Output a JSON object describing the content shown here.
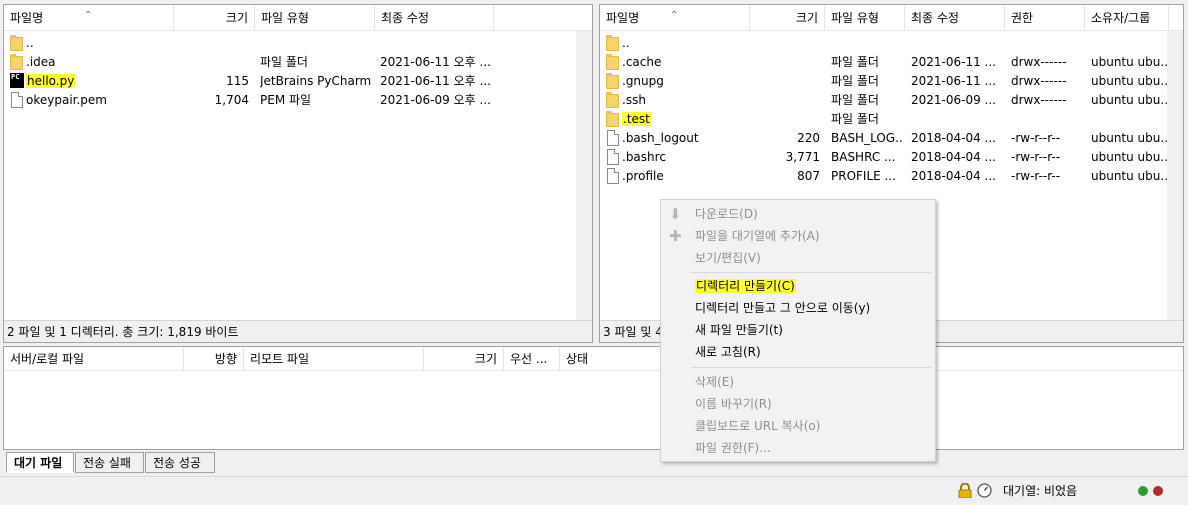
{
  "local": {
    "columns": {
      "name": "파일명",
      "size": "크기",
      "type": "파일 유형",
      "modified": "최종 수정"
    },
    "rows": [
      {
        "icon": "folder-icon",
        "name": "..",
        "size": "",
        "type": "",
        "modified": ""
      },
      {
        "icon": "folder-icon",
        "name": ".idea",
        "size": "",
        "type": "파일 폴더",
        "modified": "2021-06-11 오후 ..."
      },
      {
        "icon": "pycharm-file-icon",
        "name": "hello.py",
        "size": "115",
        "type": "JetBrains PyCharm...",
        "modified": "2021-06-11 오후 ..."
      },
      {
        "icon": "file-icon",
        "name": "okeypair.pem",
        "size": "1,704",
        "type": "PEM 파일",
        "modified": "2021-06-09 오후 ..."
      }
    ],
    "status": "2 파일 및 1 디렉터리. 총 크기: 1,819 바이트"
  },
  "remote": {
    "columns": {
      "name": "파일명",
      "size": "크기",
      "type": "파일 유형",
      "modified": "최종 수정",
      "perms": "권한",
      "owner": "소유자/그룹"
    },
    "rows": [
      {
        "icon": "folder-icon",
        "name": "..",
        "size": "",
        "type": "",
        "modified": "",
        "perms": "",
        "owner": ""
      },
      {
        "icon": "folder-icon",
        "name": ".cache",
        "size": "",
        "type": "파일 폴더",
        "modified": "2021-06-11 ...",
        "perms": "drwx------",
        "owner": "ubuntu ubu..."
      },
      {
        "icon": "folder-icon",
        "name": ".gnupg",
        "size": "",
        "type": "파일 폴더",
        "modified": "2021-06-11 ...",
        "perms": "drwx------",
        "owner": "ubuntu ubu..."
      },
      {
        "icon": "folder-icon",
        "name": ".ssh",
        "size": "",
        "type": "파일 폴더",
        "modified": "2021-06-09 ...",
        "perms": "drwx------",
        "owner": "ubuntu ubu..."
      },
      {
        "icon": "folder-icon",
        "name": ".test",
        "size": "",
        "type": "파일 폴더",
        "modified": "",
        "perms": "",
        "owner": ""
      },
      {
        "icon": "file-icon",
        "name": ".bash_logout",
        "size": "220",
        "type": "BASH_LOG...",
        "modified": "2018-04-04 ...",
        "perms": "-rw-r--r--",
        "owner": "ubuntu ubu..."
      },
      {
        "icon": "file-icon",
        "name": ".bashrc",
        "size": "3,771",
        "type": "BASHRC ...",
        "modified": "2018-04-04 ...",
        "perms": "-rw-r--r--",
        "owner": "ubuntu ubu..."
      },
      {
        "icon": "file-icon",
        "name": ".profile",
        "size": "807",
        "type": "PROFILE ...",
        "modified": "2018-04-04 ...",
        "perms": "-rw-r--r--",
        "owner": "ubuntu ubu..."
      }
    ],
    "status": "3 파일 및 4"
  },
  "queue": {
    "columns": {
      "server_local": "서버/로컬 파일",
      "direction": "방향",
      "remote": "리모트 파일",
      "size": "크기",
      "priority": "우선 ...",
      "status": "상태"
    }
  },
  "tabs": [
    "대기 파일",
    "전송 실패",
    "전송 성공"
  ],
  "footer": {
    "queue_status": "대기열: 비었음"
  },
  "context_menu": {
    "items": [
      {
        "label": "다운로드(D)",
        "enabled": false,
        "icon": "download-icon"
      },
      {
        "label": "파일을 대기열에 추가(A)",
        "enabled": false,
        "icon": "add-to-queue-icon"
      },
      {
        "label": "보기/편집(V)",
        "enabled": false
      },
      {
        "label": "디렉터리 만들기(C)",
        "enabled": true,
        "highlight": true
      },
      {
        "label": "디렉터리 만들고 그 안으로 이동(y)",
        "enabled": true
      },
      {
        "label": "새 파일 만들기(t)",
        "enabled": true
      },
      {
        "label": "새로 고침(R)",
        "enabled": true
      },
      {
        "label": "삭제(E)",
        "enabled": false
      },
      {
        "label": "이름 바꾸기(R)",
        "enabled": false
      },
      {
        "label": "클립보드로 URL 복사(o)",
        "enabled": false
      },
      {
        "label": "파일 권한(F)...",
        "enabled": false
      }
    ]
  },
  "colors": {
    "highlight": "#ffff30",
    "disabled_text": "#8f8f8f",
    "led_green": "#2e9b2e",
    "led_red": "#b52a2a"
  }
}
